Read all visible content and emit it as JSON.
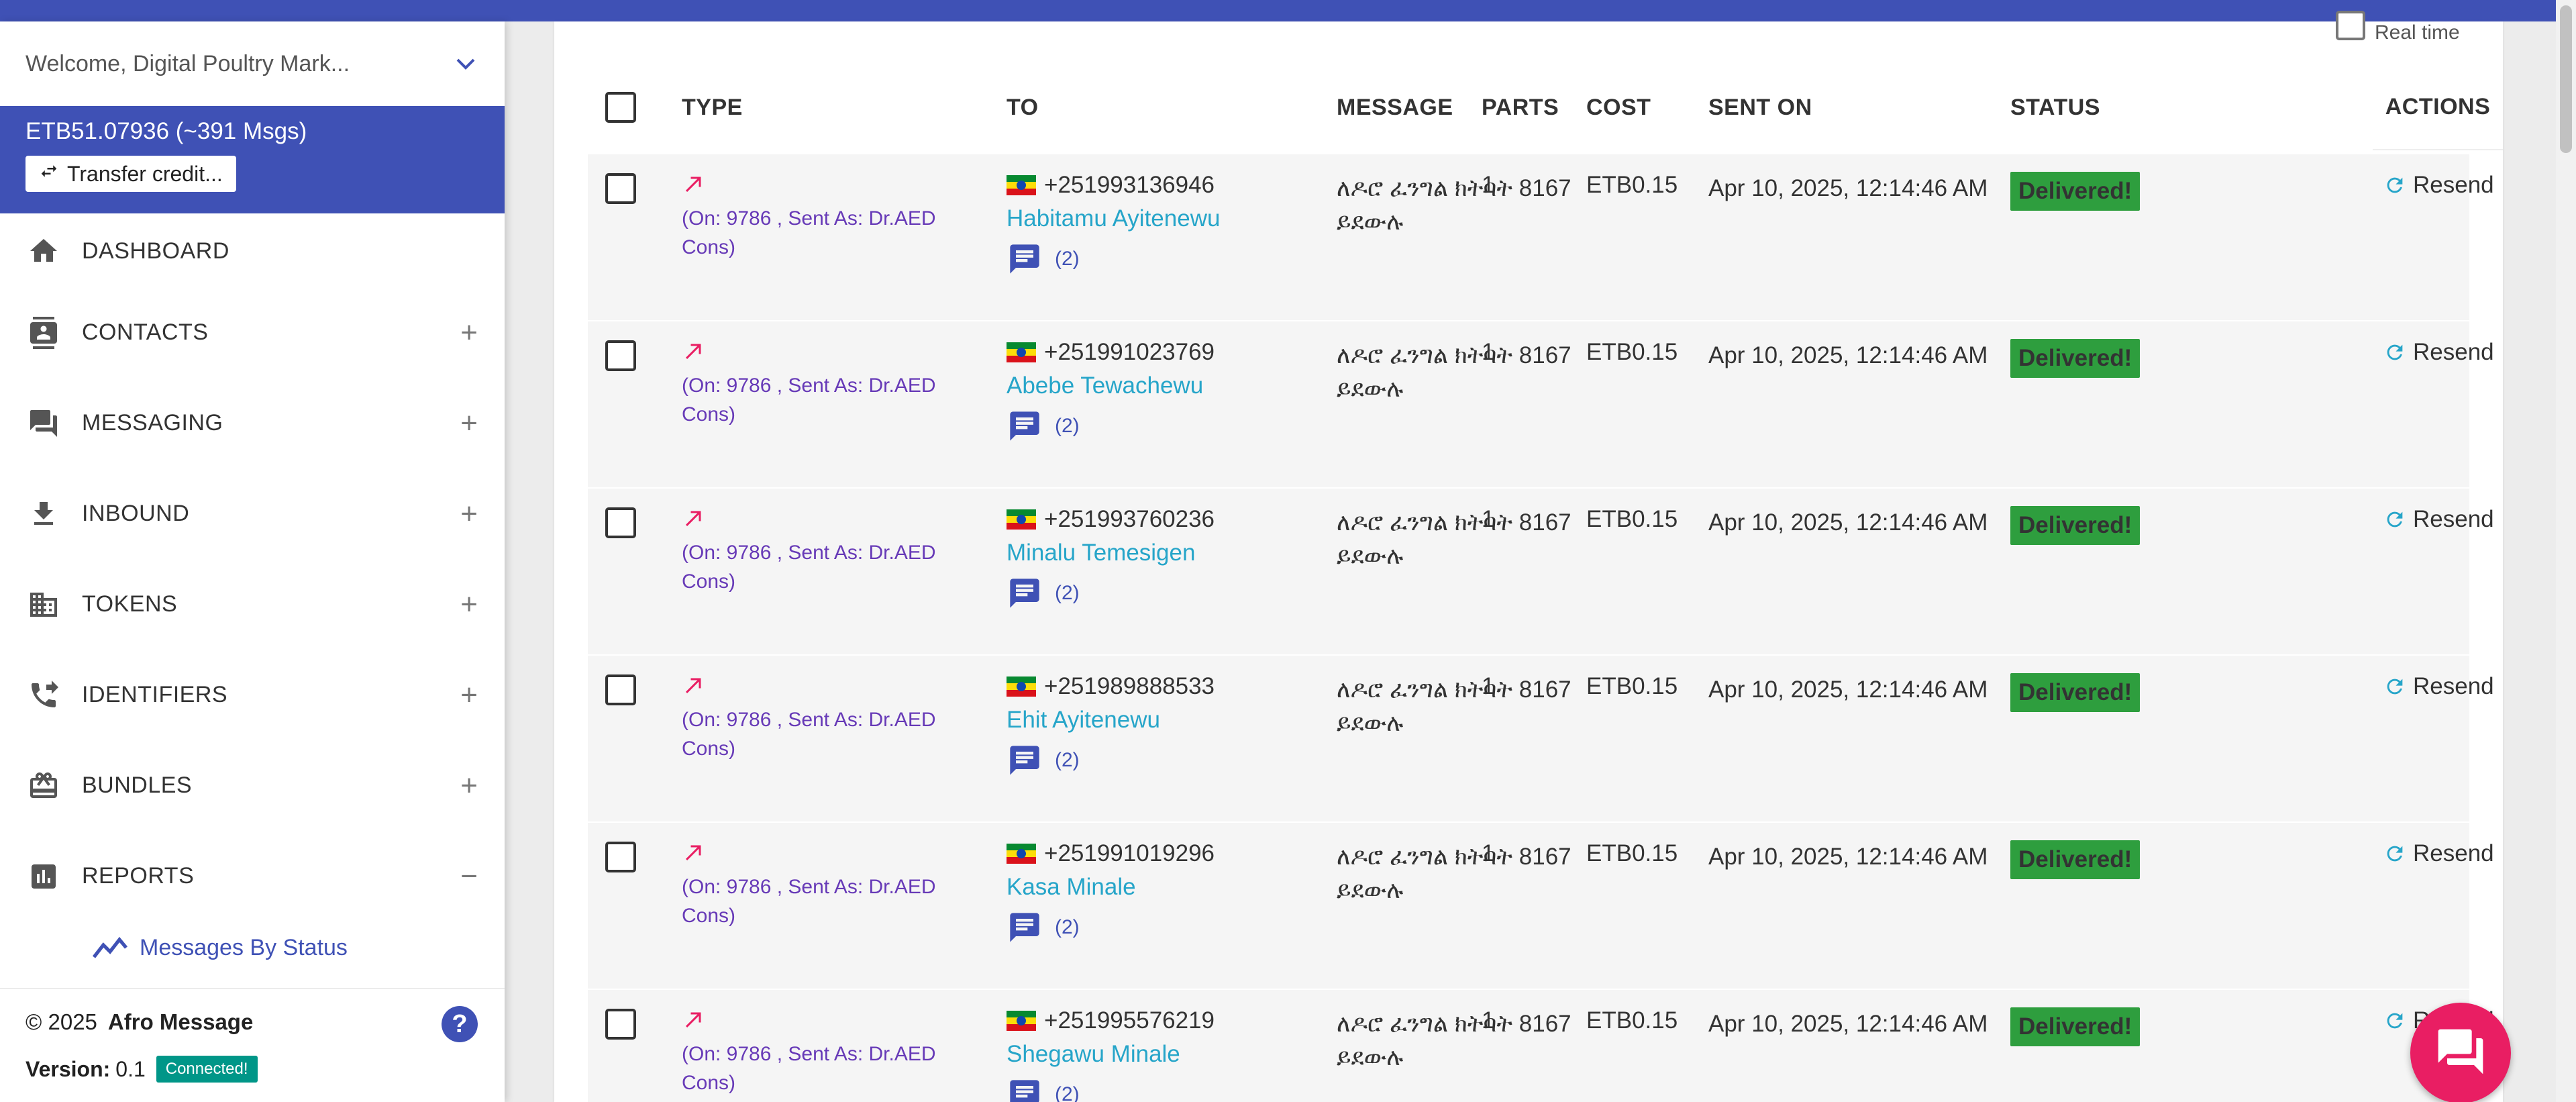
{
  "sidebar": {
    "welcome": "Welcome, Digital Poultry Mark...",
    "balance": "ETB51.07936 (~391 Msgs)",
    "transfer_label": "Transfer credit...",
    "nav": [
      {
        "label": "DASHBOARD",
        "icon": "home-icon",
        "toggle": ""
      },
      {
        "label": "CONTACTS",
        "icon": "contacts-icon",
        "toggle": "+"
      },
      {
        "label": "MESSAGING",
        "icon": "chat-icon",
        "toggle": "+"
      },
      {
        "label": "INBOUND",
        "icon": "download-icon",
        "toggle": "+"
      },
      {
        "label": "TOKENS",
        "icon": "building-icon",
        "toggle": "+"
      },
      {
        "label": "IDENTIFIERS",
        "icon": "phone-forward-icon",
        "toggle": "+"
      },
      {
        "label": "BUNDLES",
        "icon": "gift-icon",
        "toggle": "+"
      },
      {
        "label": "REPORTS",
        "icon": "bar-chart-icon",
        "toggle": "−"
      }
    ],
    "sub_item": "Messages By Status",
    "footer": {
      "copyright": "© 2025",
      "brand": "Afro Message",
      "version_label": "Version:",
      "version": "0.1",
      "connection": "Connected!"
    }
  },
  "table": {
    "realtime_label": "Real time",
    "headers": {
      "type": "TYPE",
      "to": "TO",
      "message": "MESSAGE",
      "parts": "PARTS",
      "cost": "COST",
      "sent_on": "SENT ON",
      "status": "STATUS",
      "actions": "ACTIONS"
    },
    "rows": [
      {
        "direction": "(On: 9786 , Sent As: Dr.AED Cons)",
        "phone": "+251993136946",
        "name": "Habitamu Ayitenewu",
        "msg_count": "(2)",
        "message": "ለዶሮ ፈንግል ክትባት 8167 ይደውሉ",
        "parts": "1",
        "cost": "ETB0.15",
        "sent_on": "Apr 10, 2025, 12:14:46 AM",
        "status": "Delivered!",
        "action": "Resend"
      },
      {
        "direction": "(On: 9786 , Sent As: Dr.AED Cons)",
        "phone": "+251991023769",
        "name": "Abebe Tewachewu",
        "msg_count": "(2)",
        "message": "ለዶሮ ፈንግል ክትባት 8167 ይደውሉ",
        "parts": "1",
        "cost": "ETB0.15",
        "sent_on": "Apr 10, 2025, 12:14:46 AM",
        "status": "Delivered!",
        "action": "Resend"
      },
      {
        "direction": "(On: 9786 , Sent As: Dr.AED Cons)",
        "phone": "+251993760236",
        "name": "Minalu Temesigen",
        "msg_count": "(2)",
        "message": "ለዶሮ ፈንግል ክትባት 8167 ይደውሉ",
        "parts": "1",
        "cost": "ETB0.15",
        "sent_on": "Apr 10, 2025, 12:14:46 AM",
        "status": "Delivered!",
        "action": "Resend"
      },
      {
        "direction": "(On: 9786 , Sent As: Dr.AED Cons)",
        "phone": "+251989888533",
        "name": "Ehit Ayitenewu",
        "msg_count": "(2)",
        "message": "ለዶሮ ፈንግል ክትባት 8167 ይደውሉ",
        "parts": "1",
        "cost": "ETB0.15",
        "sent_on": "Apr 10, 2025, 12:14:46 AM",
        "status": "Delivered!",
        "action": "Resend"
      },
      {
        "direction": "(On: 9786 , Sent As: Dr.AED Cons)",
        "phone": "+251991019296",
        "name": "Kasa Minale",
        "msg_count": "(2)",
        "message": "ለዶሮ ፈንግል ክትባት 8167 ይደውሉ",
        "parts": "1",
        "cost": "ETB0.15",
        "sent_on": "Apr 10, 2025, 12:14:46 AM",
        "status": "Delivered!",
        "action": "Resend"
      },
      {
        "direction": "(On: 9786 , Sent As: Dr.AED Cons)",
        "phone": "+251995576219",
        "name": "Shegawu Minale",
        "msg_count": "(2)",
        "message": "ለዶሮ ፈንግል ክትባት 8167 ይደውሉ",
        "parts": "1",
        "cost": "ETB0.15",
        "sent_on": "Apr 10, 2025, 12:14:46 AM",
        "status": "Delivered!",
        "action": "Resend"
      }
    ]
  },
  "colors": {
    "primary": "#3f51b5",
    "link": "#26a5c9",
    "delivered": "#2e9e3e",
    "fab": "#e91e63"
  }
}
